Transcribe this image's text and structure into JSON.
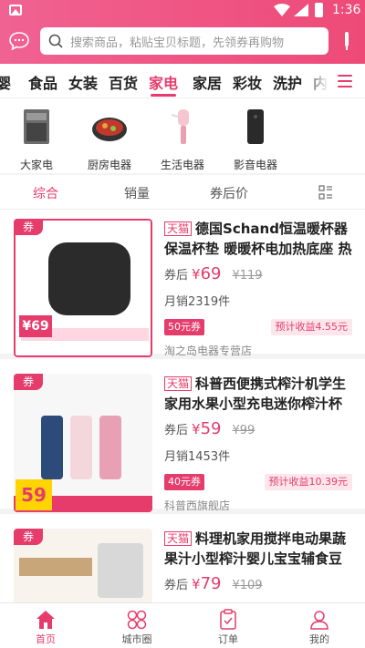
{
  "status_bar": {
    "time": "1:36"
  },
  "search": {
    "placeholder": "搜索商品，粘贴宝贝标题，先领券再购物"
  },
  "categories": [
    "婴",
    "食品",
    "女装",
    "百货",
    "家电",
    "家居",
    "彩妆",
    "洗护",
    "内"
  ],
  "active_category": "家电",
  "subcategories": [
    "大家电",
    "厨房电器",
    "生活电器",
    "影音电器"
  ],
  "sort_options": [
    "综合",
    "销量",
    "券后价"
  ],
  "active_sort": "综合",
  "products": [
    {
      "tag": "券",
      "mall": "天猫",
      "title": "德国Schand恒温暖杯器保温杯垫 暖暖杯电加热底座 热牛...",
      "price_label": "券后",
      "currency": "¥",
      "price": "69",
      "original_price": "¥119",
      "sales": "月销2319件",
      "coupon": "50元券",
      "earnings": "预计收益4.55元",
      "shop": "淘之岛电器专营店"
    },
    {
      "tag": "券",
      "mall": "天猫",
      "title": "科普西便携式榨汁机学生家用水果小型充电迷你榨汁杯电...",
      "price_label": "券后",
      "currency": "¥",
      "price": "59",
      "original_price": "¥99",
      "sales": "月销1453件",
      "coupon": "40元券",
      "earnings": "预计收益10.39元",
      "shop": "科普西旗舰店"
    },
    {
      "tag": "券",
      "mall": "天猫",
      "title": "料理机家用搅拌电动果蔬果汁小型榨汁婴儿宝宝辅食豆浆...",
      "price_label": "券后",
      "currency": "¥",
      "price": "79",
      "original_price": "¥109"
    }
  ],
  "image_text": {
    "p1_promo": "¥69",
    "p2_promo": "59"
  },
  "bottom_nav": [
    "首页",
    "城市圈",
    "订单",
    "我的"
  ],
  "colors": {
    "accent": "#e53c6c",
    "header_gradient_start": "#f06292",
    "header_gradient_end": "#ee4a77"
  }
}
